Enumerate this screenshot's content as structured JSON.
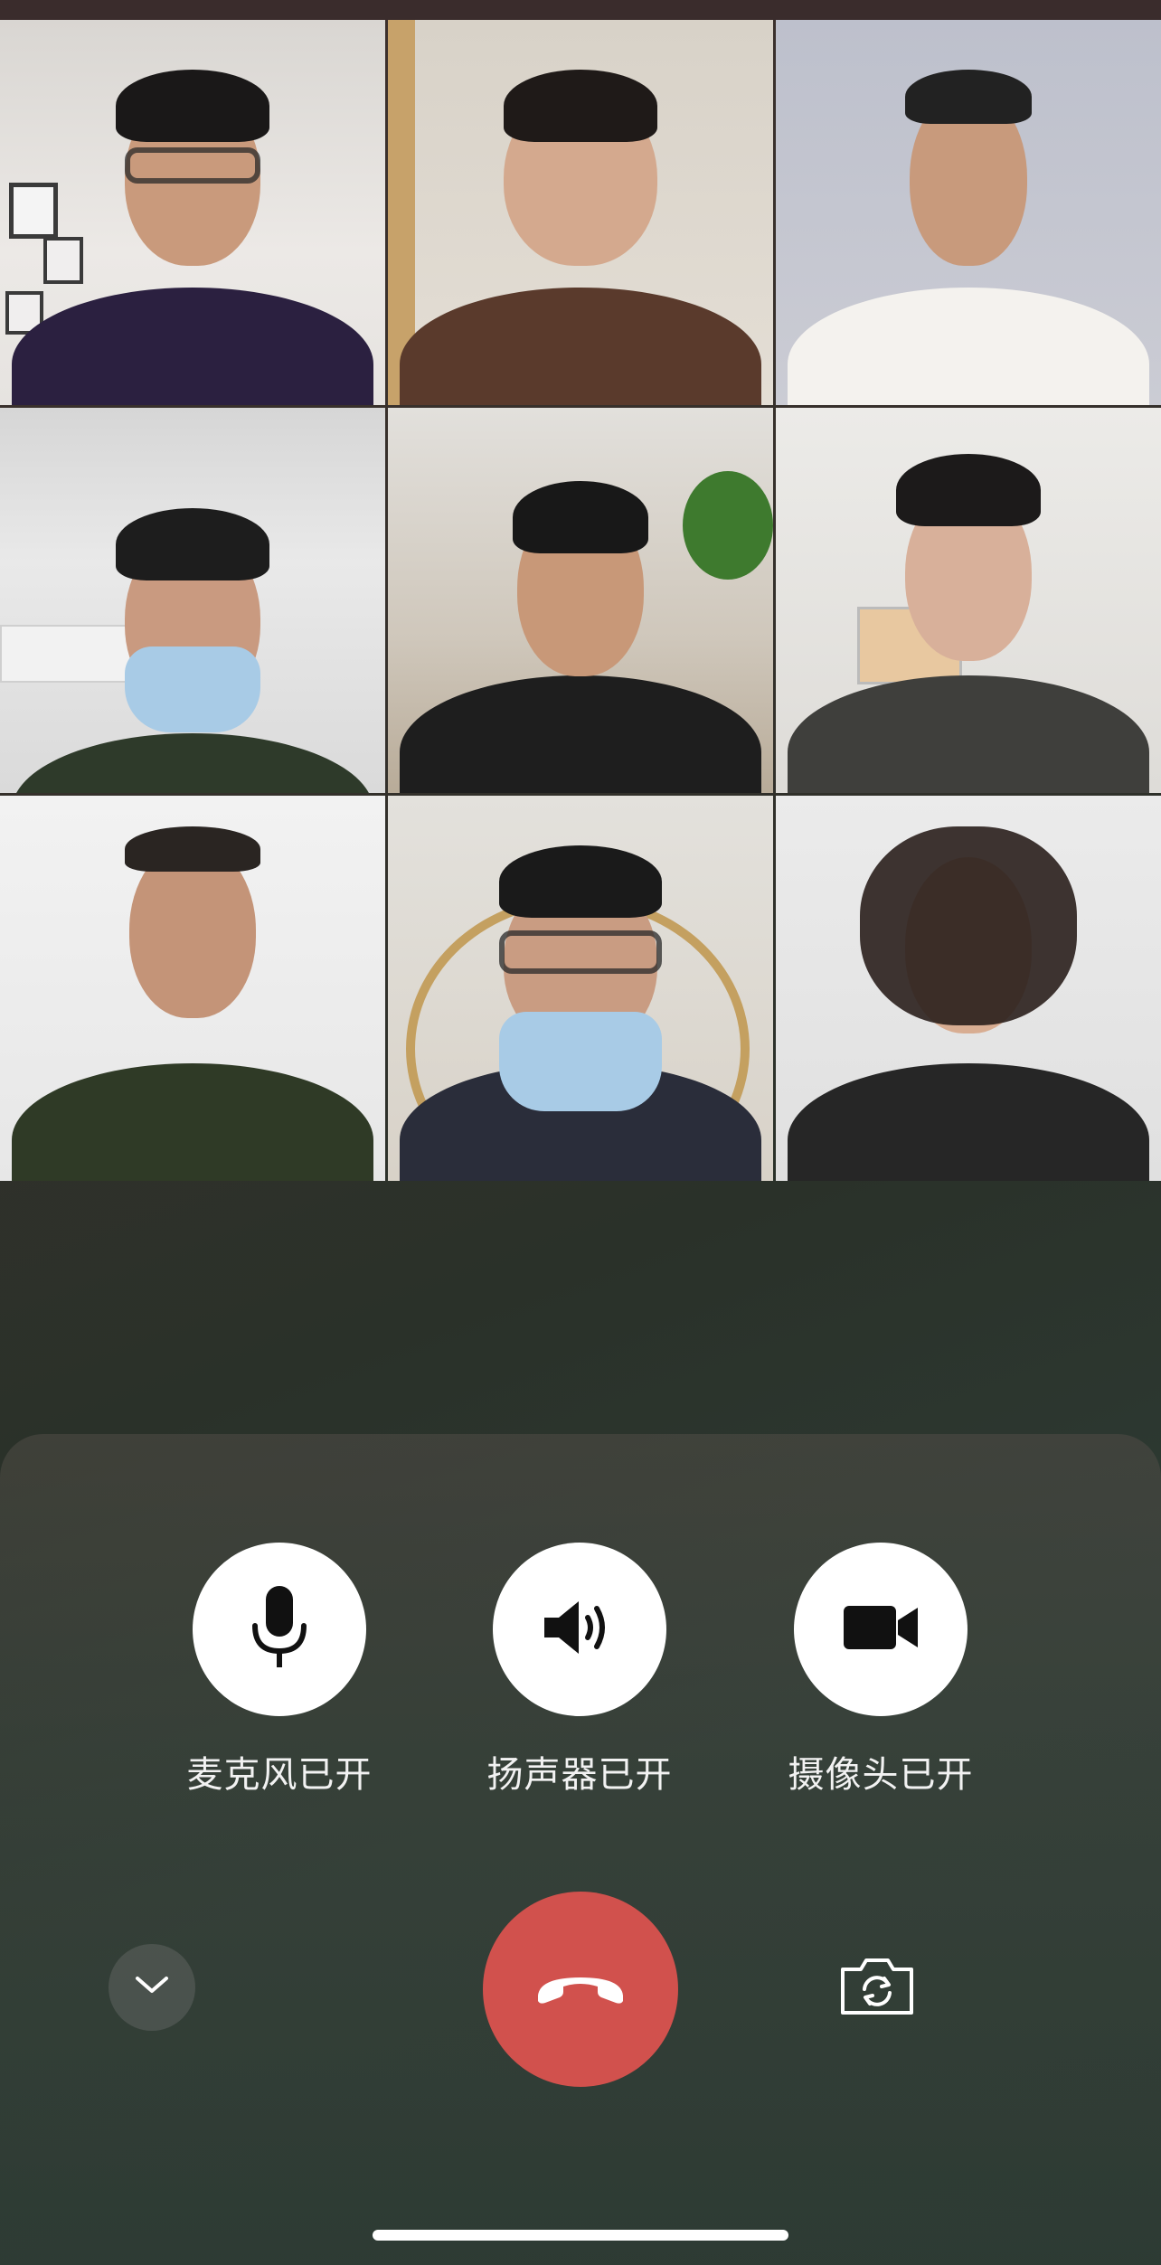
{
  "call": {
    "participants": [
      {
        "id": 1,
        "scene": "office-wall-frames",
        "glasses": true,
        "mask": false
      },
      {
        "id": 2,
        "scene": "indoor-plain",
        "glasses": false,
        "mask": false
      },
      {
        "id": 3,
        "scene": "grey-wall",
        "glasses": false,
        "mask": false
      },
      {
        "id": 4,
        "scene": "room-aircon",
        "glasses": false,
        "mask": true
      },
      {
        "id": 5,
        "scene": "room-plant",
        "glasses": false,
        "mask": false
      },
      {
        "id": 6,
        "scene": "room-map",
        "glasses": false,
        "mask": false
      },
      {
        "id": 7,
        "scene": "uniform-white-wall",
        "glasses": false,
        "mask": false
      },
      {
        "id": 8,
        "scene": "mirror-room",
        "glasses": true,
        "mask": true
      },
      {
        "id": 9,
        "scene": "white-room",
        "glasses": false,
        "mask": false
      }
    ]
  },
  "controls": {
    "microphone": {
      "label": "麦克风已开",
      "icon": "microphone-icon"
    },
    "speaker": {
      "label": "扬声器已开",
      "icon": "speaker-icon"
    },
    "camera": {
      "label": "摄像头已开",
      "icon": "camera-icon"
    }
  },
  "actions": {
    "collapse": {
      "icon": "chevron-down-icon"
    },
    "hangup": {
      "icon": "phone-hangup-icon",
      "color": "#d1514d"
    },
    "flip_camera": {
      "icon": "camera-flip-icon"
    }
  }
}
